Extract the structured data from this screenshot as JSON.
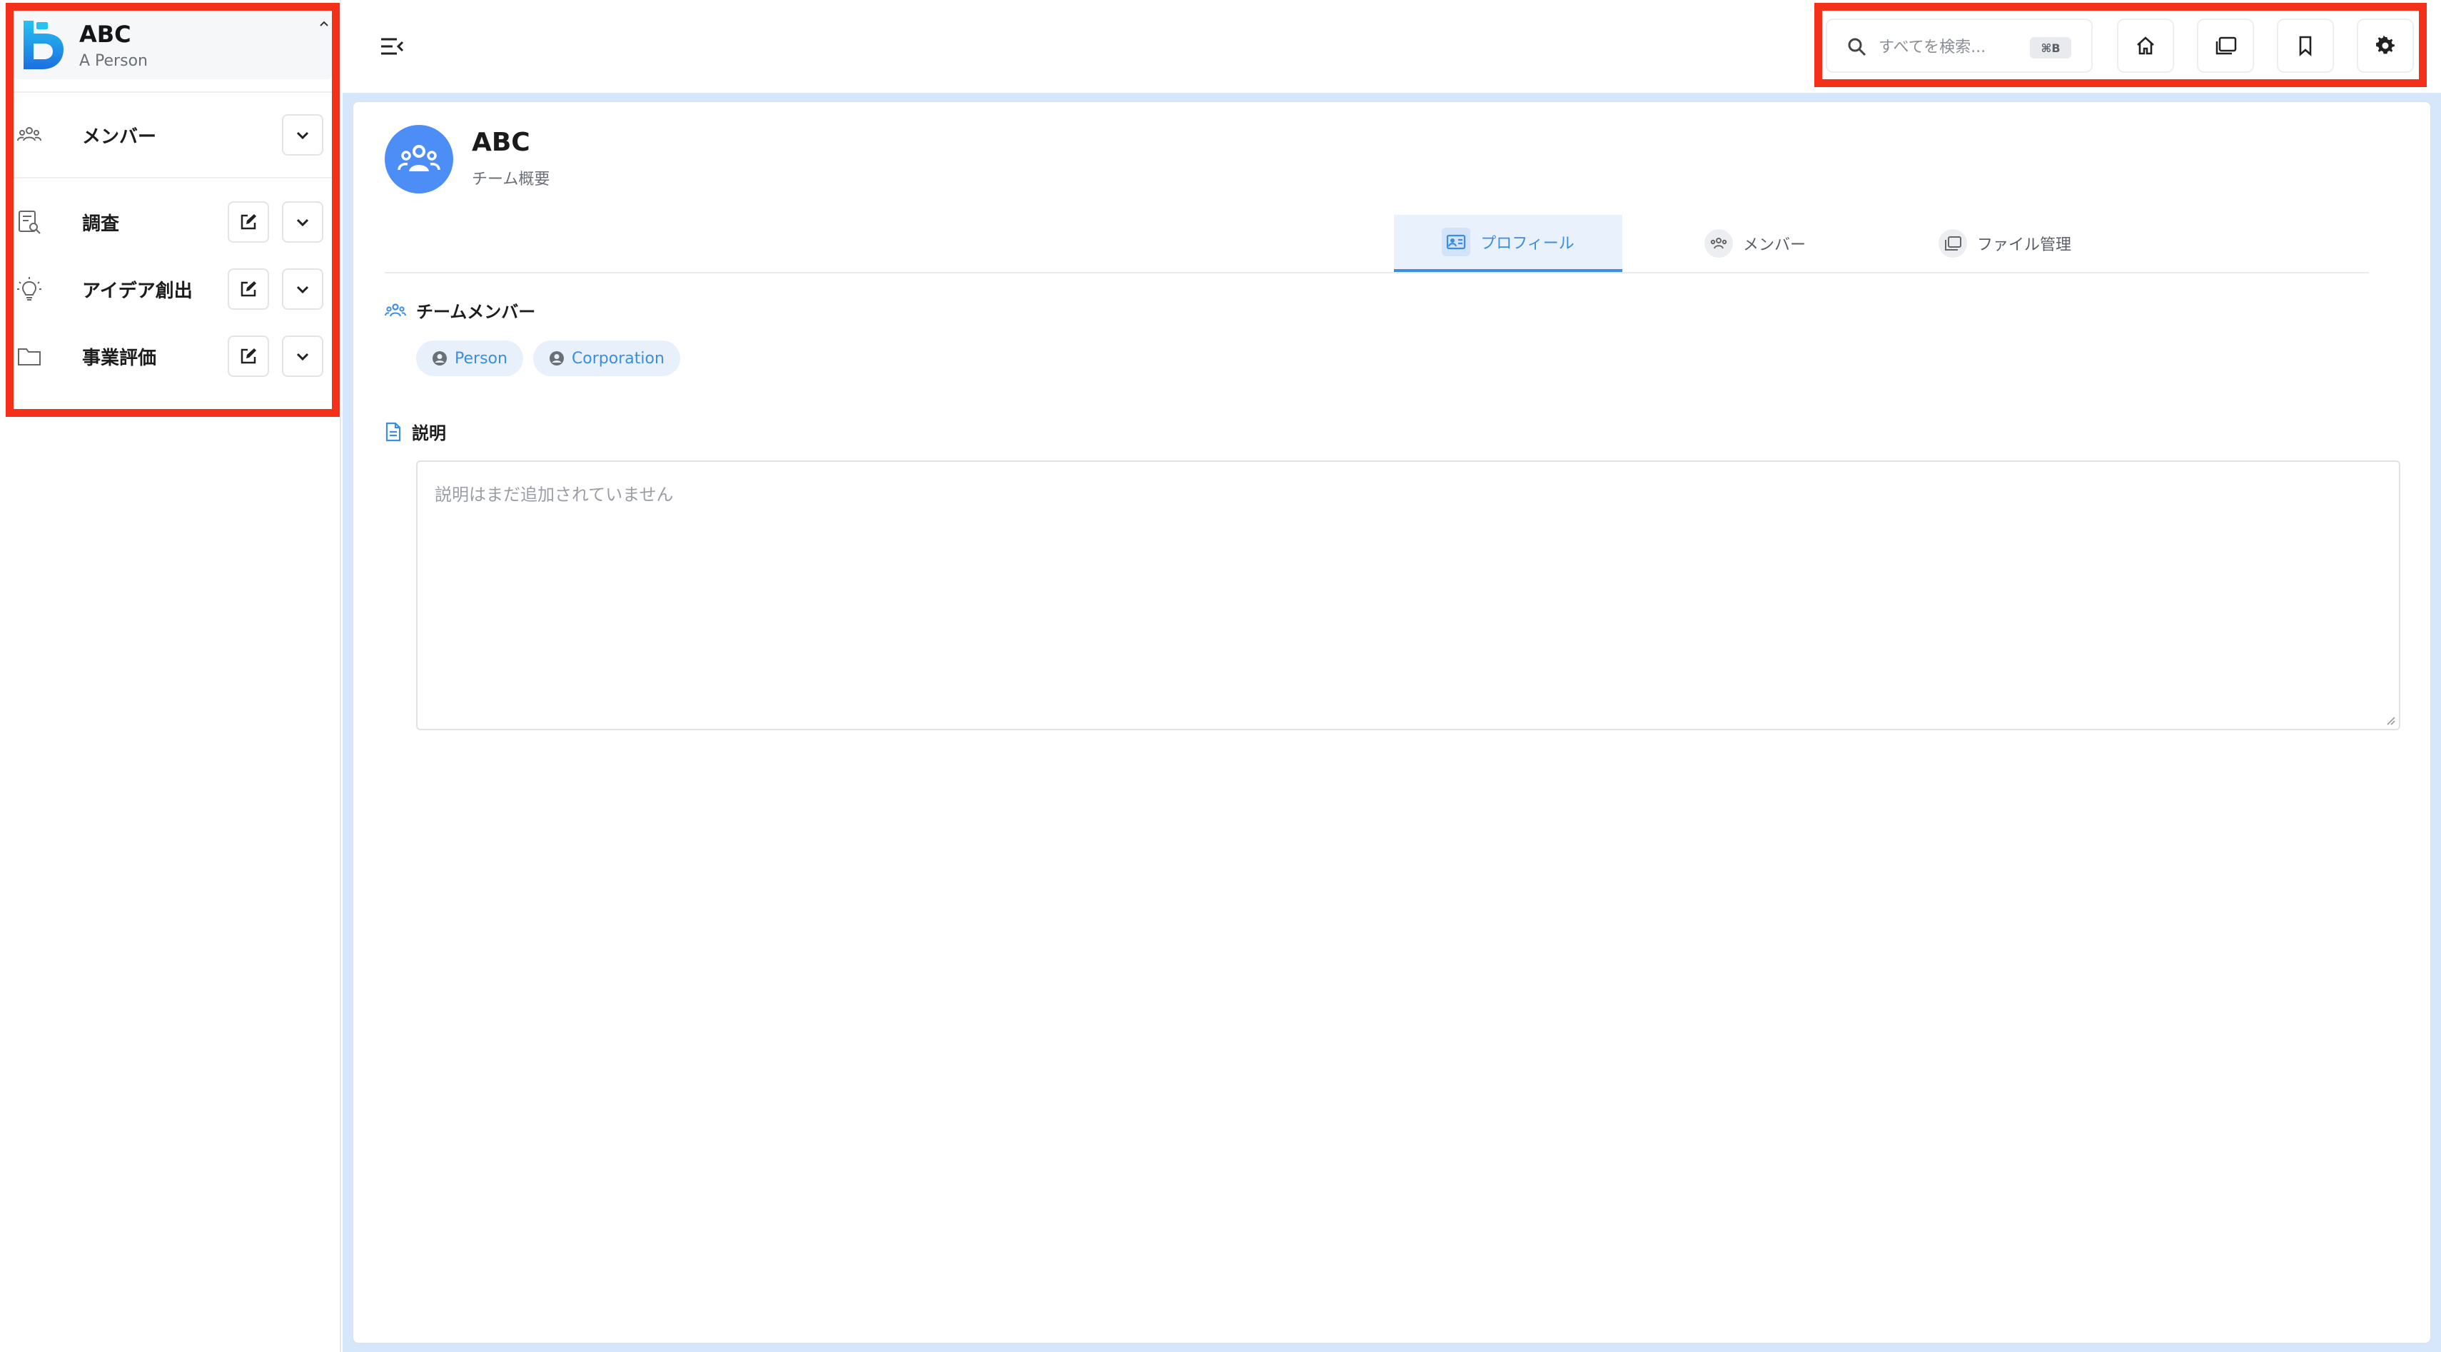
{
  "colors": {
    "accent": "#3b8de0",
    "highlight": "#f4301b",
    "avatar": "#4d8df6",
    "main_bg": "#d6e6fb"
  },
  "sidebar": {
    "title": "ABC",
    "subtitle": "A Person",
    "items": [
      {
        "label": "メンバー",
        "icon": "team-icon",
        "has_edit": false
      },
      {
        "label": "調査",
        "icon": "research-icon",
        "has_edit": true
      },
      {
        "label": "アイデア創出",
        "icon": "lightbulb-icon",
        "has_edit": true
      },
      {
        "label": "事業評価",
        "icon": "folder-icon",
        "has_edit": true
      }
    ]
  },
  "topbar": {
    "search_placeholder": "すべてを検索...",
    "search_shortcut": "⌘B",
    "buttons": [
      "home-icon",
      "files-icon",
      "bookmark-icon",
      "gear-icon"
    ]
  },
  "team": {
    "title": "ABC",
    "subtitle": "チーム概要"
  },
  "tabs": [
    {
      "label": "プロフィール",
      "active": true
    },
    {
      "label": "メンバー",
      "active": false
    },
    {
      "label": "ファイル管理",
      "active": false
    }
  ],
  "members_section": {
    "heading": "チームメンバー",
    "chips": [
      "Person",
      "Corporation"
    ]
  },
  "description_section": {
    "heading": "説明",
    "placeholder": "説明はまだ追加されていません"
  }
}
